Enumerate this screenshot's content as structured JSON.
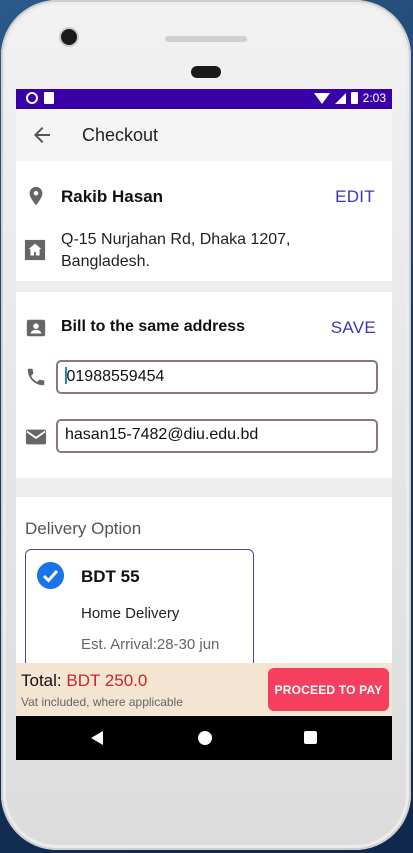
{
  "status_bar": {
    "time": "2:03"
  },
  "app_bar": {
    "title": "Checkout",
    "back_icon": "arrow-left-icon"
  },
  "shipping": {
    "name": "Rakib Hasan",
    "edit_label": "EDIT",
    "address": "Q-15 Nurjahan Rd, Dhaka 1207, Bangladesh.",
    "location_icon": "location-pin-icon",
    "home_icon": "home-icon"
  },
  "billing": {
    "title": "Bill to the same address",
    "save_label": "SAVE",
    "phone_value": "01988559454",
    "email_value": "hasan15-7482@diu.edu.bd",
    "contact_icon": "contact-card-icon",
    "phone_icon": "phone-icon",
    "email_icon": "mail-icon"
  },
  "delivery": {
    "section_label": "Delivery Option",
    "option": {
      "price": "BDT 55",
      "method": "Home Delivery",
      "arrival": "Est. Arrival:28-30 jun",
      "selected": true
    }
  },
  "summary": {
    "total_label": "Total:",
    "total_amount": "BDT 250.0",
    "vat_note": "Vat included, where applicable",
    "pay_button": "PROCEED TO PAY"
  },
  "colors": {
    "status_bar": "#3a00a8",
    "accent_link": "#3a35b8",
    "pay_button": "#f43f5e",
    "total_amount": "#c62828",
    "check": "#1a73e8"
  }
}
